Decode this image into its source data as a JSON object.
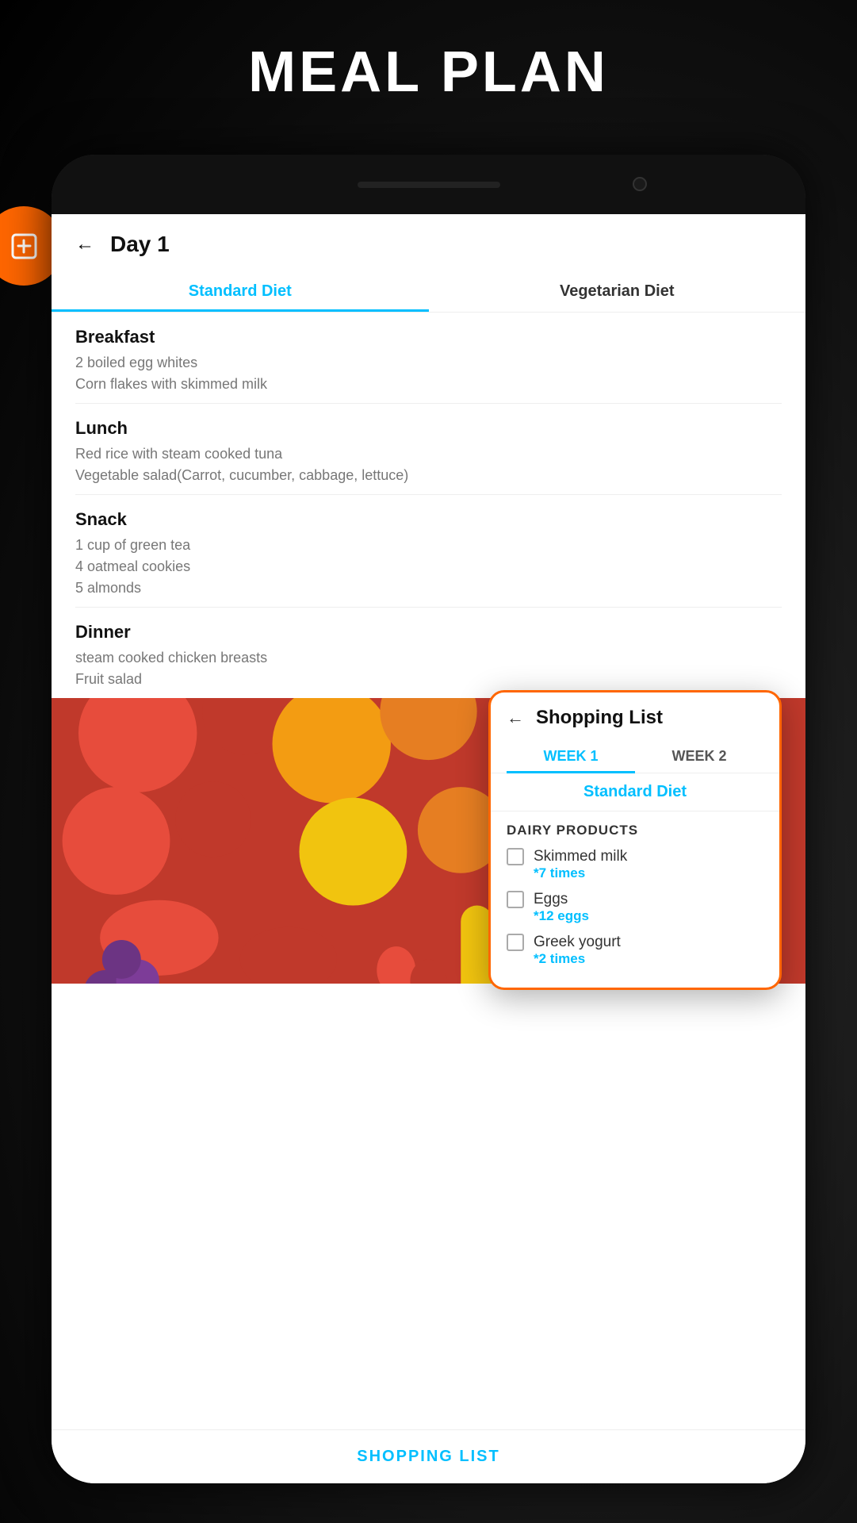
{
  "page": {
    "title": "MEAL PLAN"
  },
  "header": {
    "back_arrow": "←",
    "day_title": "Day 1"
  },
  "diet_tabs": [
    {
      "label": "Standard Diet",
      "active": true
    },
    {
      "label": "Vegetarian Diet",
      "active": false
    }
  ],
  "meals": [
    {
      "name": "Breakfast",
      "items": [
        "2 boiled egg whites",
        "Corn flakes with skimmed milk"
      ]
    },
    {
      "name": "Lunch",
      "items": [
        "Red rice with steam cooked tuna",
        "Vegetable salad(Carrot, cucumber, cabbage, lettuce)"
      ]
    },
    {
      "name": "Snack",
      "items": [
        "1 cup of green tea",
        "4 oatmeal cookies",
        "5 almonds"
      ]
    },
    {
      "name": "Dinner",
      "items": [
        "steam cooked chicken breasts",
        "Fruit salad"
      ]
    }
  ],
  "shopping_button": "SHOPPING LIST",
  "shopping_list": {
    "back_arrow": "←",
    "title": "Shopping List",
    "tabs": [
      {
        "label": "WEEK 1",
        "active": true
      },
      {
        "label": "WEEK 2",
        "active": false
      }
    ],
    "diet_label": "Standard Diet",
    "sections": [
      {
        "title": "DAIRY PRODUCTS",
        "items": [
          {
            "name": "Skimmed milk",
            "count": "*7 times"
          },
          {
            "name": "Eggs",
            "count": "*12 eggs"
          },
          {
            "name": "Greek yogurt",
            "count": "*2 times"
          }
        ]
      }
    ]
  },
  "colors": {
    "accent": "#00BFFF",
    "orange": "#FF6600",
    "text_primary": "#111111",
    "text_secondary": "#777777",
    "divider": "#eeeeee"
  }
}
